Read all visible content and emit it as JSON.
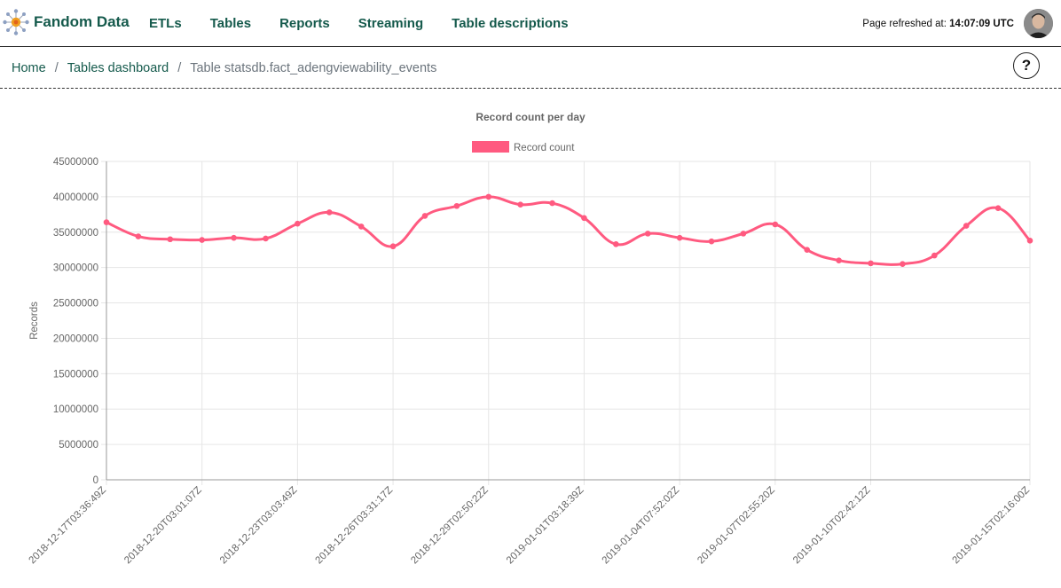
{
  "header": {
    "brand_name": "Fandom Data",
    "nav": [
      "ETLs",
      "Tables",
      "Reports",
      "Streaming",
      "Table descriptions"
    ],
    "refresh_label": "Page refreshed at:",
    "refresh_time": "14:07:09 UTC"
  },
  "breadcrumb": {
    "home": "Home",
    "dashboard": "Tables dashboard",
    "current": "Table statsdb.fact_adengviewability_events",
    "separator": "/"
  },
  "help_label": "?",
  "colors": {
    "brand": "#155a4c",
    "series": "#ff5a80",
    "grid": "#e6e6e6"
  },
  "chart_data": {
    "type": "line",
    "title": "Record count per day",
    "xlabel": "",
    "ylabel": "Records",
    "legend": {
      "entries": [
        "Record count"
      ],
      "placement": "top-center"
    },
    "grid": true,
    "ylim": [
      0,
      45000000
    ],
    "yticks": [
      0,
      5000000,
      10000000,
      15000000,
      20000000,
      25000000,
      30000000,
      35000000,
      40000000,
      45000000
    ],
    "xtick_labels": [
      "2018-12-17T03:36:49Z",
      "2018-12-20T03:01:07Z",
      "2018-12-23T03:03:49Z",
      "2018-12-26T03:31:17Z",
      "2018-12-29T02:50:22Z",
      "2019-01-01T03:18:39Z",
      "2019-01-04T07:52:02Z",
      "2019-01-07T02:55:20Z",
      "2019-01-10T02:42:12Z",
      "2019-01-15T02:16:00Z"
    ],
    "x": [
      "2018-12-17",
      "2018-12-18",
      "2018-12-19",
      "2018-12-20",
      "2018-12-21",
      "2018-12-22",
      "2018-12-23",
      "2018-12-24",
      "2018-12-25",
      "2018-12-26",
      "2018-12-27",
      "2018-12-28",
      "2018-12-29",
      "2018-12-30",
      "2018-12-31",
      "2019-01-01",
      "2019-01-02",
      "2019-01-03",
      "2019-01-04",
      "2019-01-05",
      "2019-01-06",
      "2019-01-07",
      "2019-01-08",
      "2019-01-09",
      "2019-01-10",
      "2019-01-11",
      "2019-01-12",
      "2019-01-13",
      "2019-01-14",
      "2019-01-15"
    ],
    "series": [
      {
        "name": "Record count",
        "values": [
          36400000,
          34400000,
          34000000,
          33900000,
          34200000,
          34100000,
          36200000,
          37800000,
          35800000,
          33000000,
          37300000,
          38700000,
          40000000,
          38900000,
          39100000,
          37000000,
          33300000,
          34800000,
          34200000,
          33700000,
          34800000,
          36100000,
          32500000,
          31000000,
          30600000,
          30500000,
          31700000,
          35900000,
          38400000,
          33800000
        ]
      }
    ]
  }
}
